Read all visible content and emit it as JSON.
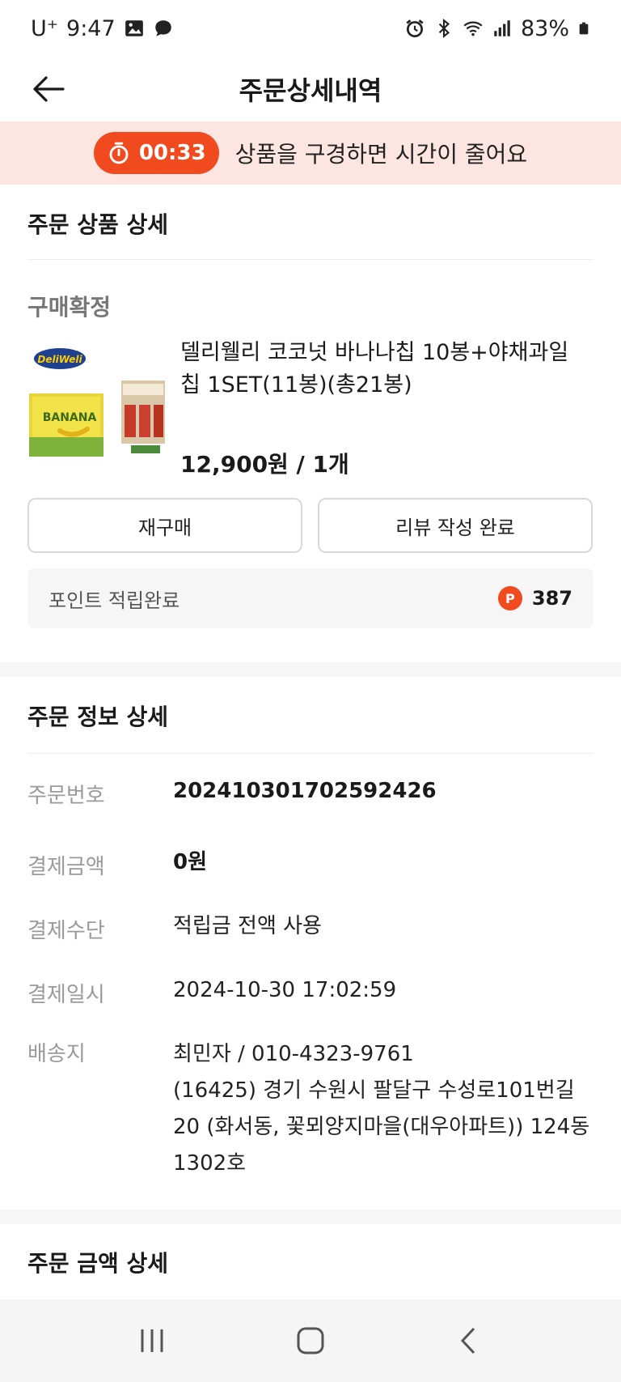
{
  "status_bar": {
    "carrier": "U⁺",
    "time": "9:47",
    "battery": "83%"
  },
  "header": {
    "title": "주문상세내역"
  },
  "timer_banner": {
    "time": "00:33",
    "message": "상품을 구경하면 시간이 줄어요",
    "accent": "#f04a1e"
  },
  "order_product": {
    "section_title": "주문 상품 상세",
    "status": "구매확정",
    "image_logo": "DeliWeli",
    "name": "델리웰리 코코넛 바나나칩 10봉+야채과일칩 1SET(11봉)(총21봉)",
    "price": "12,900원 / 1개",
    "rebuy_label": "재구매",
    "review_label": "리뷰 작성 완료",
    "point_label": "포인트 적립완료",
    "point_badge": "P",
    "point_value": "387"
  },
  "order_info": {
    "section_title": "주문 정보 상세",
    "rows": [
      {
        "key": "주문번호",
        "value": "20241030170259242​6"
      },
      {
        "key": "결제금액",
        "value": "0원"
      },
      {
        "key": "결제수단",
        "value": "적립금 전액 사용"
      },
      {
        "key": "결제일시",
        "value": "2024-10-30 17:02:59"
      },
      {
        "key": "배송지",
        "value": "최민자 / 010-4323-9761"
      }
    ],
    "address": "(16425) 경기 수원시 팔달구 수성로101번길 20 (화서동, 꽃뫼양지마을(대우아파트)) 124동 1302호"
  },
  "order_amount": {
    "section_title": "주문 금액 상세"
  }
}
